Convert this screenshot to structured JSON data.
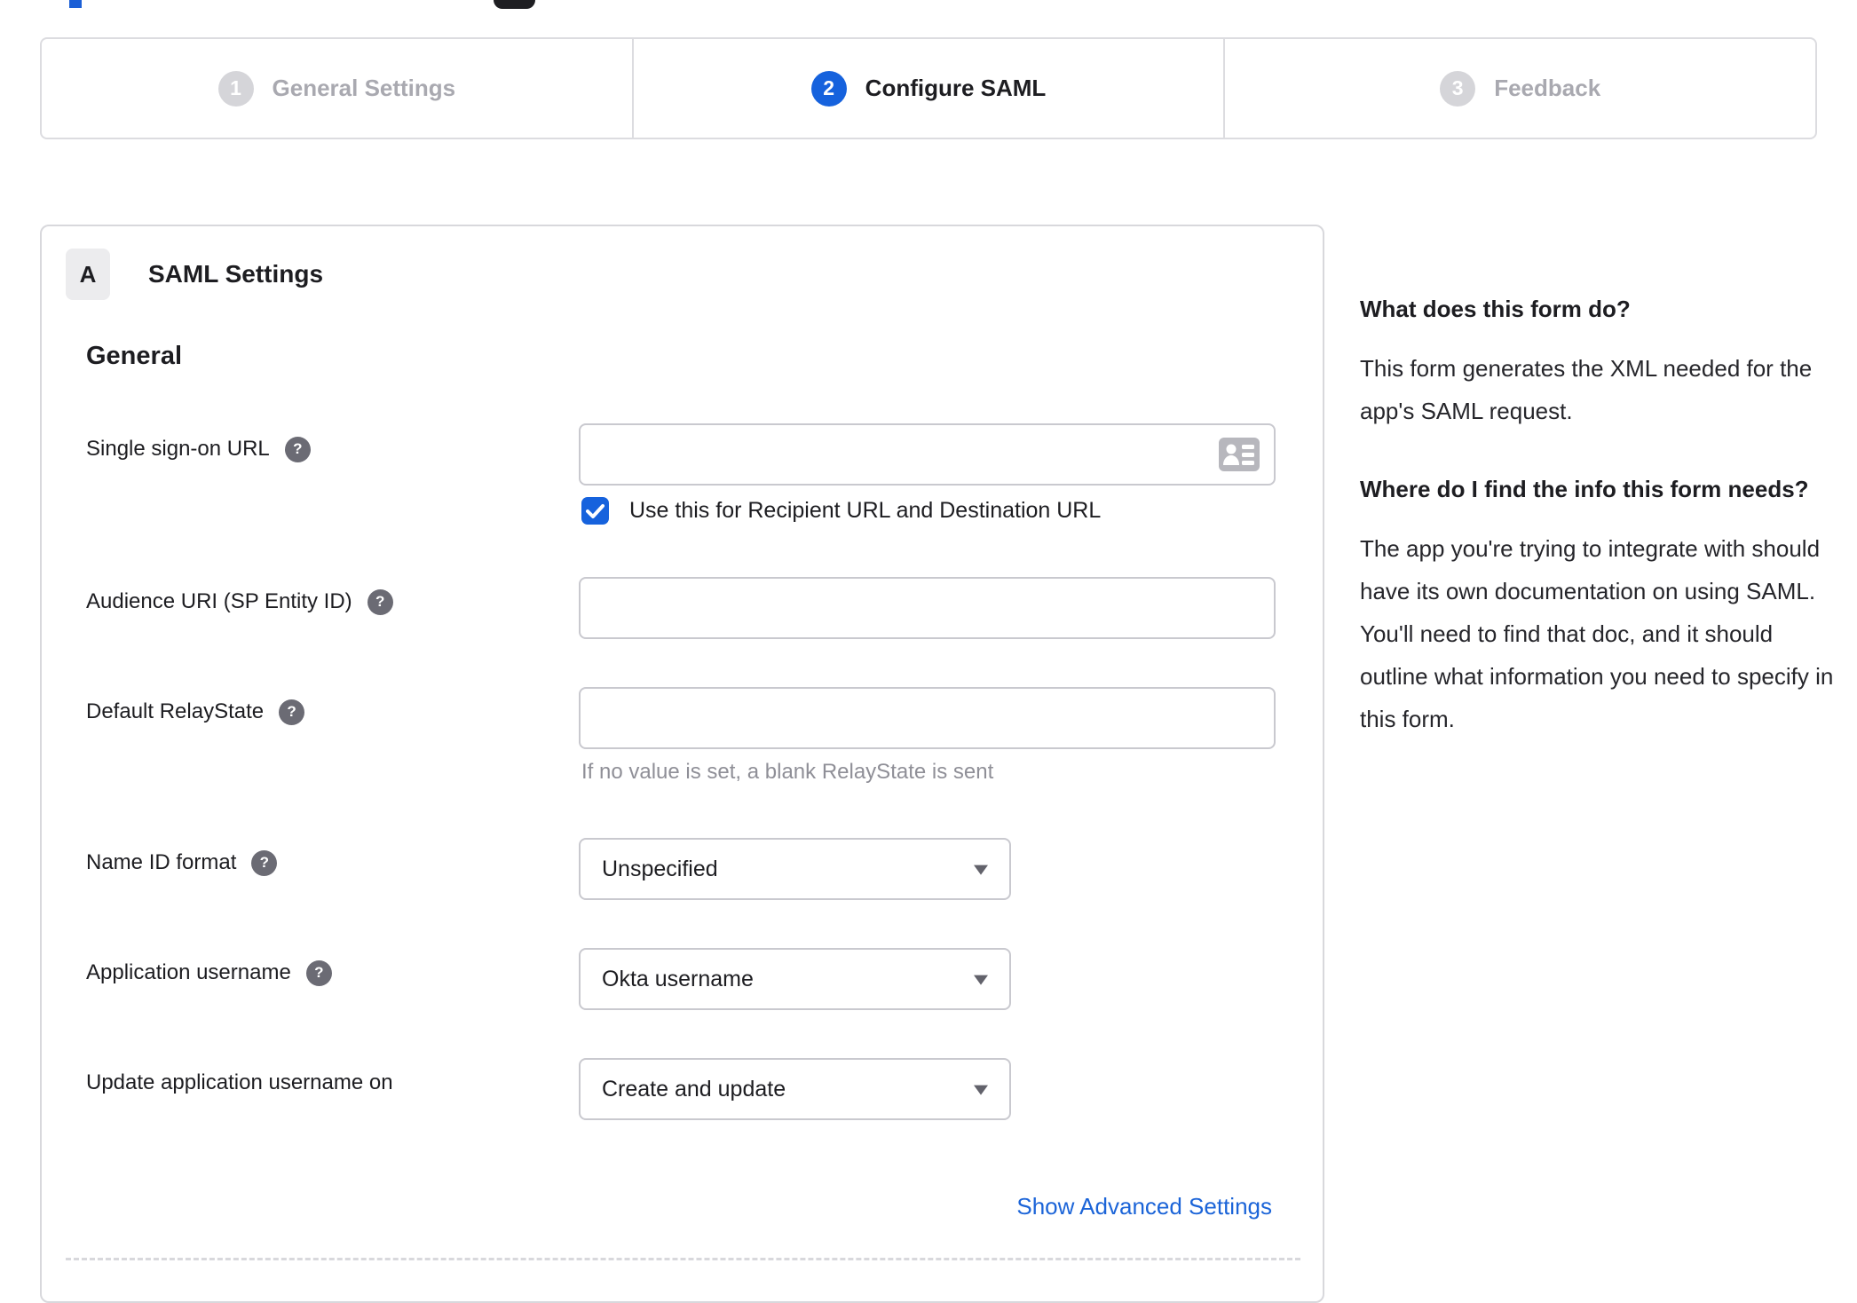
{
  "stepper": {
    "steps": [
      {
        "number": "1",
        "label": "General Settings",
        "state": "inactive"
      },
      {
        "number": "2",
        "label": "Configure SAML",
        "state": "active"
      },
      {
        "number": "3",
        "label": "Feedback",
        "state": "inactive"
      }
    ]
  },
  "panel": {
    "badge": "A",
    "title": "SAML Settings",
    "group_title": "General",
    "fields": {
      "single_sign_on_url": {
        "label": "Single sign-on URL",
        "value": "",
        "checkbox": {
          "checked": true,
          "label": "Use this for Recipient URL and Destination URL"
        }
      },
      "audience_uri": {
        "label": "Audience URI (SP Entity ID)",
        "value": ""
      },
      "default_relay_state": {
        "label": "Default RelayState",
        "value": "",
        "hint": "If no value is set, a blank RelayState is sent"
      },
      "name_id_format": {
        "label": "Name ID format",
        "value": "Unspecified"
      },
      "application_username": {
        "label": "Application username",
        "value": "Okta username"
      },
      "update_application_username_on": {
        "label": "Update application username on",
        "value": "Create and update"
      }
    },
    "advanced_link": "Show Advanced Settings"
  },
  "sidebar": {
    "q1": "What does this form do?",
    "a1": "This form generates the XML needed for the app's SAML request.",
    "q2": "Where do I find the info this form needs?",
    "a2": "The app you're trying to integrate with should have its own documentation on using SAML. You'll need to find that doc, and it should outline what information you need to specify in this form."
  },
  "icons": {
    "help": "?"
  },
  "colors": {
    "accent_blue": "#1662dd",
    "link_blue": "#1b64d8",
    "inactive_gray": "#d5d5d9",
    "text_dark": "#1d1d21",
    "muted_text": "#8f8f97",
    "border": "#d8d8dc"
  }
}
